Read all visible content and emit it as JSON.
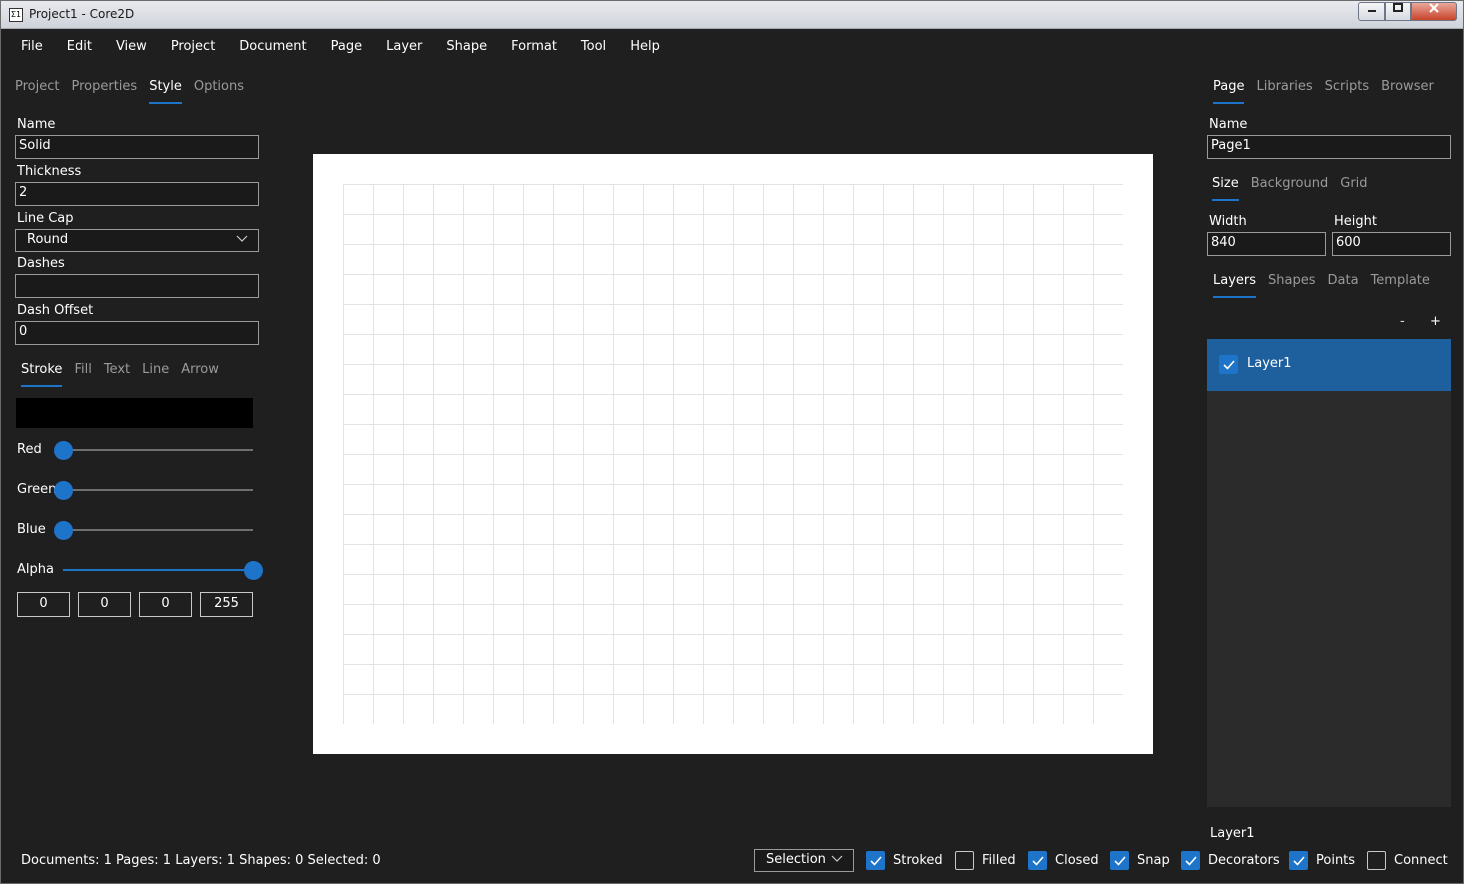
{
  "window": {
    "title": "Project1 - Core2D",
    "icon_text": "Σ1"
  },
  "menu": [
    "File",
    "Edit",
    "View",
    "Project",
    "Document",
    "Page",
    "Layer",
    "Shape",
    "Format",
    "Tool",
    "Help"
  ],
  "left_panel": {
    "tabs": [
      "Project",
      "Properties",
      "Style",
      "Options"
    ],
    "active_tab": "Style",
    "style": {
      "name_label": "Name",
      "name_value": "Solid",
      "thickness_label": "Thickness",
      "thickness_value": "2",
      "line_cap_label": "Line Cap",
      "line_cap_value": "Round",
      "dashes_label": "Dashes",
      "dashes_value": "",
      "dash_offset_label": "Dash Offset",
      "dash_offset_value": "0"
    },
    "color_tabs": [
      "Stroke",
      "Fill",
      "Text",
      "Line",
      "Arrow"
    ],
    "active_color_tab": "Stroke",
    "color": {
      "preview": "#000000",
      "red_label": "Red",
      "red": 0,
      "green_label": "Green",
      "green": 0,
      "blue_label": "Blue",
      "blue": 0,
      "alpha_label": "Alpha",
      "alpha": 255,
      "red_text": "0",
      "green_text": "0",
      "blue_text": "0",
      "alpha_text": "255"
    }
  },
  "right_panel": {
    "tabs": [
      "Page",
      "Libraries",
      "Scripts",
      "Browser"
    ],
    "active_tab": "Page",
    "name_label": "Name",
    "name_value": "Page1",
    "sub_tabs": [
      "Size",
      "Background",
      "Grid"
    ],
    "active_sub_tab": "Size",
    "width_label": "Width",
    "width_value": "840",
    "height_label": "Height",
    "height_value": "600",
    "layer_tabs": [
      "Layers",
      "Shapes",
      "Data",
      "Template"
    ],
    "active_layer_tab": "Layers",
    "remove_label": "-",
    "add_label": "+",
    "layers": [
      {
        "name": "Layer1",
        "visible": true
      }
    ],
    "current_layer": "Layer1"
  },
  "canvas": {
    "page_width": 840,
    "page_height": 600,
    "grid_cell": 30
  },
  "status_bar": {
    "text": "Documents: 1 Pages: 1 Layers: 1 Shapes: 0 Selected: 0",
    "tool": "Selection",
    "options": [
      {
        "label": "Stroked",
        "checked": true
      },
      {
        "label": "Filled",
        "checked": false
      },
      {
        "label": "Closed",
        "checked": true
      },
      {
        "label": "Snap",
        "checked": true
      },
      {
        "label": "Decorators",
        "checked": true
      },
      {
        "label": "Points",
        "checked": true
      },
      {
        "label": "Connect",
        "checked": false
      }
    ]
  },
  "colors": {
    "accent": "#1e74c9",
    "background": "#1f1f1f",
    "selected_layer": "#1e5f9e"
  }
}
